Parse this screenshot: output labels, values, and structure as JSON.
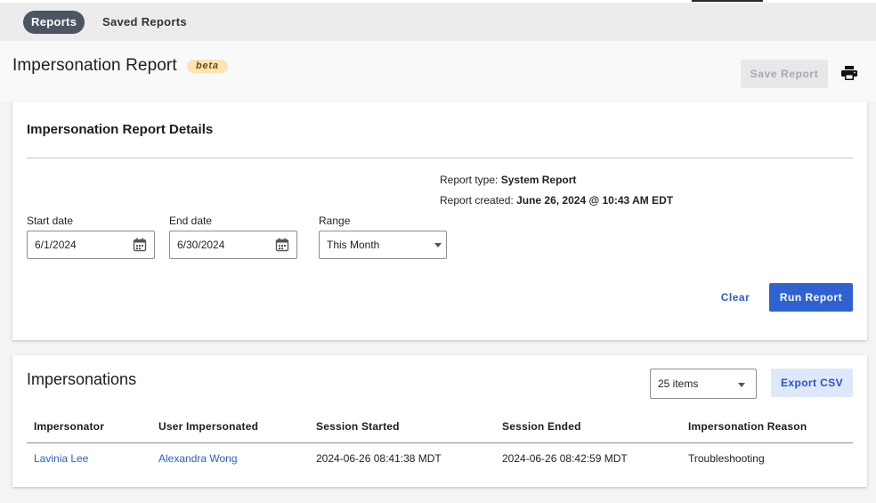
{
  "nav": {
    "tabs": [
      {
        "label": "Reports",
        "active": true
      },
      {
        "label": "Saved Reports",
        "active": false
      }
    ]
  },
  "header": {
    "title": "Impersonation Report",
    "badge": "beta",
    "save_label": "Save Report"
  },
  "details": {
    "title": "Impersonation Report Details",
    "report_type_label": "Report type:",
    "report_type_value": "System Report",
    "report_created_label": "Report created:",
    "report_created_value": "June 26, 2024 @ 10:43 AM EDT",
    "start_label": "Start date",
    "start_value": "6/1/2024",
    "end_label": "End date",
    "end_value": "6/30/2024",
    "range_label": "Range",
    "range_value": "This Month",
    "clear_label": "Clear",
    "run_label": "Run Report"
  },
  "results": {
    "title": "Impersonations",
    "items_value": "25 items",
    "export_label": "Export CSV",
    "columns": [
      "Impersonator",
      "User Impersonated",
      "Session Started",
      "Session Ended",
      "Impersonation Reason"
    ],
    "rows": [
      [
        "Lavinia Lee",
        "Alexandra Wong",
        "2024-06-26 08:41:38 MDT",
        "2024-06-26 08:42:59 MDT",
        "Troubleshooting"
      ]
    ]
  },
  "colors": {
    "accent": "#2e62d1",
    "link": "#2a5fc9",
    "badge_bg": "#fde4b3",
    "active_tab": "#4d5563"
  }
}
